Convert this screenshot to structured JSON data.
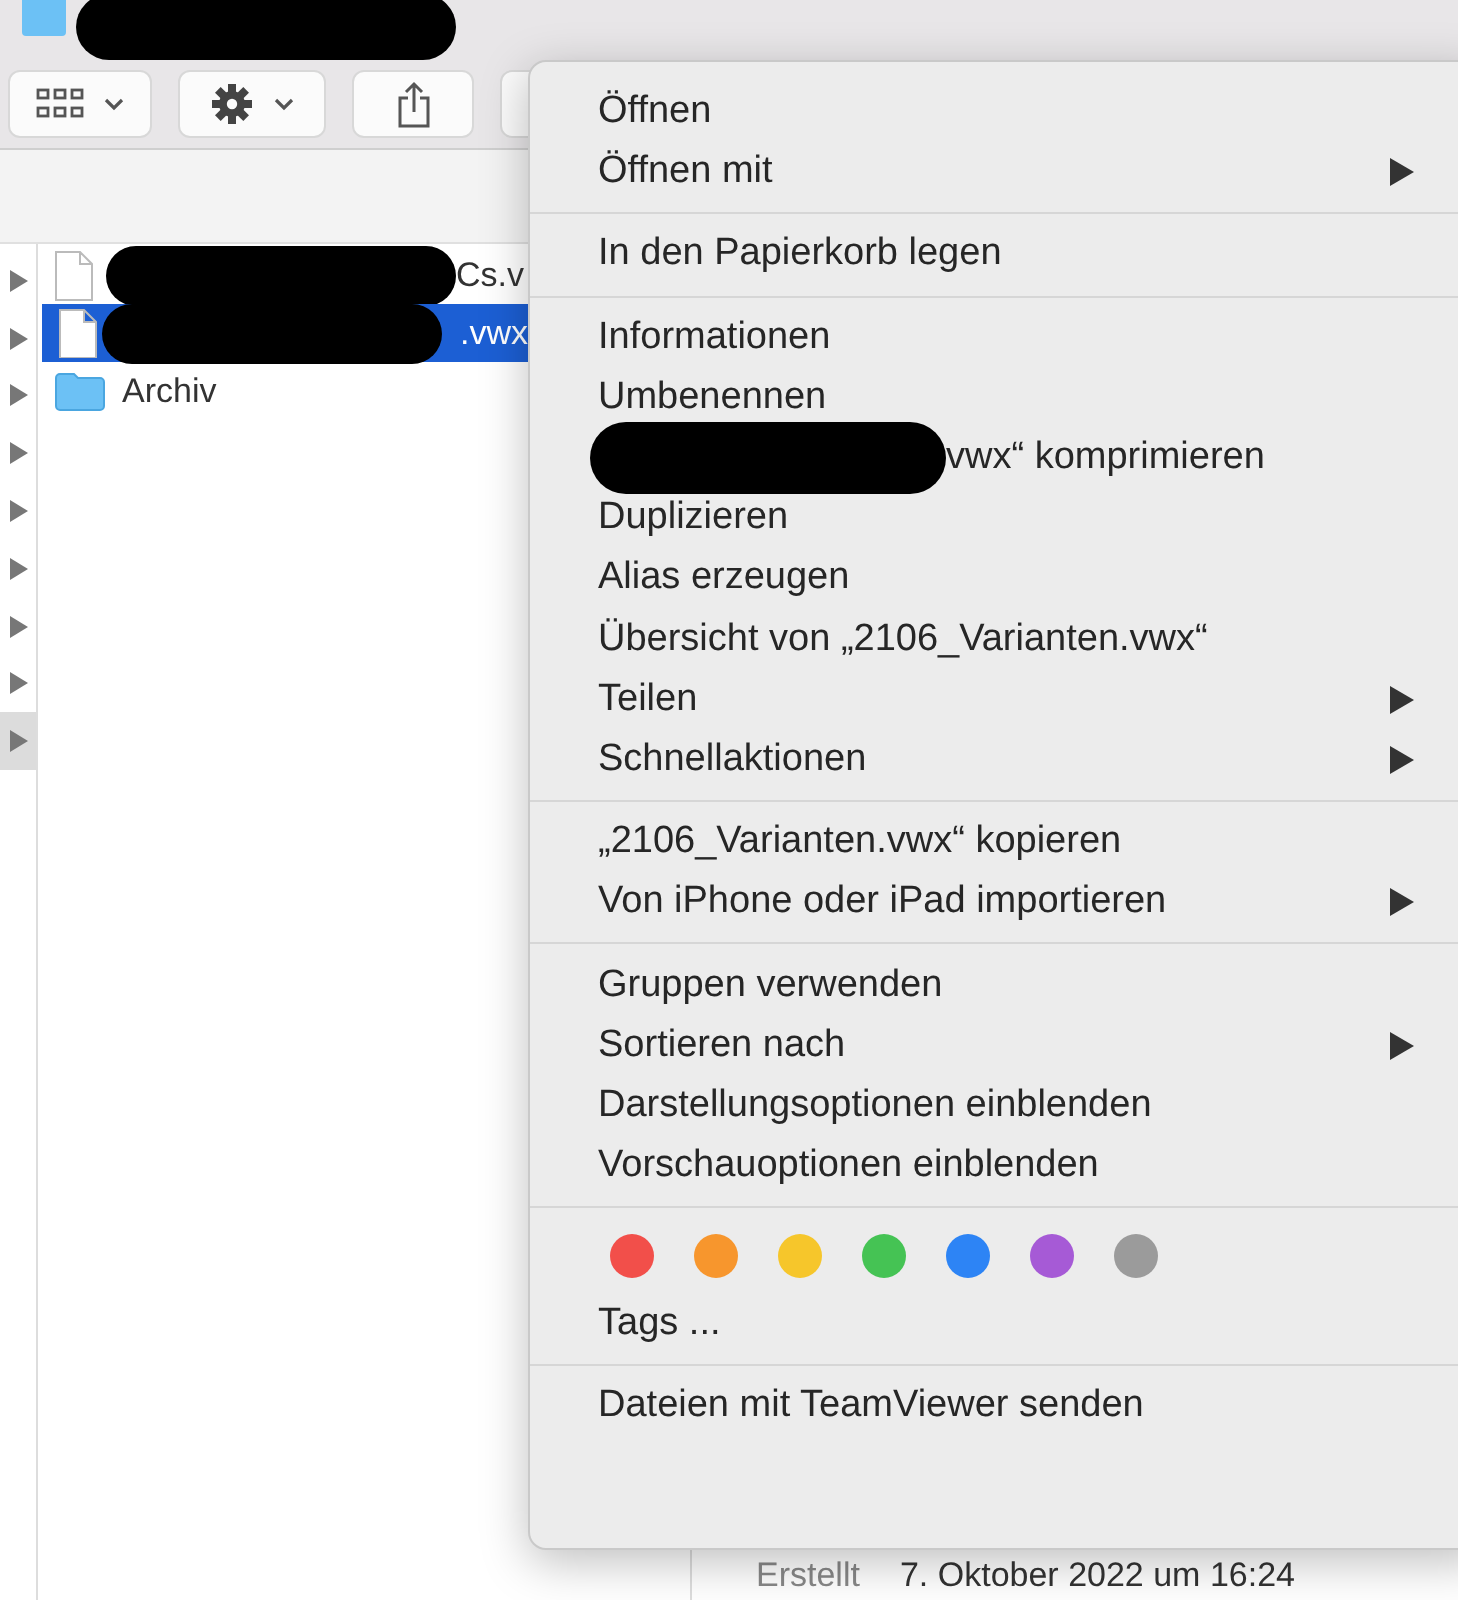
{
  "window": {
    "title_redacted": true
  },
  "toolbar": {
    "buttons": [
      {
        "kind": "view"
      },
      {
        "kind": "action"
      },
      {
        "kind": "share"
      },
      {
        "kind": "blank"
      }
    ]
  },
  "file_list": {
    "disclosures": [
      {
        "highlighted": false
      },
      {
        "highlighted": false
      },
      {
        "highlighted": false
      },
      {
        "highlighted": false
      },
      {
        "highlighted": false
      },
      {
        "highlighted": false
      },
      {
        "highlighted": false
      },
      {
        "highlighted": false
      },
      {
        "highlighted": true
      }
    ],
    "rows": [
      {
        "kind": "document",
        "name": "Cs.v",
        "redacted": true,
        "selected": false
      },
      {
        "kind": "document",
        "name": ".vwx",
        "redacted": true,
        "selected": true
      },
      {
        "kind": "folder",
        "name": "Archiv",
        "redacted": false,
        "selected": false
      }
    ]
  },
  "context_menu": {
    "sections": [
      {
        "items": [
          {
            "label": "Öffnen",
            "submenu": false,
            "redacted": false
          },
          {
            "label": "Öffnen mit",
            "submenu": true,
            "redacted": false
          }
        ]
      },
      {
        "items": [
          {
            "label": "In den Papierkorb legen",
            "submenu": false,
            "redacted": false
          }
        ]
      },
      {
        "items": [
          {
            "label": "Informationen",
            "submenu": false,
            "redacted": false
          },
          {
            "label": "Umbenennen",
            "submenu": false,
            "redacted": false
          },
          {
            "label": "vwx“ komprimieren",
            "submenu": false,
            "redacted": true
          },
          {
            "label": "Duplizieren",
            "submenu": false,
            "redacted": false
          },
          {
            "label": "Alias erzeugen",
            "submenu": false,
            "redacted": false
          },
          {
            "label": "Übersicht von „2106_Varianten.vwx“",
            "submenu": false,
            "redacted": false
          },
          {
            "label": "Teilen",
            "submenu": true,
            "redacted": false
          },
          {
            "label": "Schnellaktionen",
            "submenu": true,
            "redacted": false
          }
        ]
      },
      {
        "items": [
          {
            "label": "„2106_Varianten.vwx“ kopieren",
            "submenu": false,
            "redacted": false
          },
          {
            "label": "Von iPhone oder iPad importieren",
            "submenu": true,
            "redacted": false
          }
        ]
      },
      {
        "items": [
          {
            "label": "Gruppen verwenden",
            "submenu": false,
            "redacted": false
          },
          {
            "label": "Sortieren nach",
            "submenu": true,
            "redacted": false
          },
          {
            "label": "Darstellungsoptionen einblenden",
            "submenu": false,
            "redacted": false
          },
          {
            "label": "Vorschauoptionen einblenden",
            "submenu": false,
            "redacted": false
          }
        ]
      },
      {
        "tags": [
          {
            "color": "#f24f4a"
          },
          {
            "color": "#f7962d"
          },
          {
            "color": "#f6c62b"
          },
          {
            "color": "#45c354"
          },
          {
            "color": "#2d84f5"
          },
          {
            "color": "#a65ad6"
          },
          {
            "color": "#9b9b9b"
          }
        ],
        "items": [
          {
            "label": "Tags ...",
            "submenu": false,
            "redacted": false
          }
        ]
      },
      {
        "items": [
          {
            "label": "Dateien mit TeamViewer senden",
            "submenu": false,
            "redacted": false
          }
        ]
      }
    ]
  },
  "info": {
    "label": "Erstellt",
    "value": "7. Oktober 2022 um 16:24"
  }
}
